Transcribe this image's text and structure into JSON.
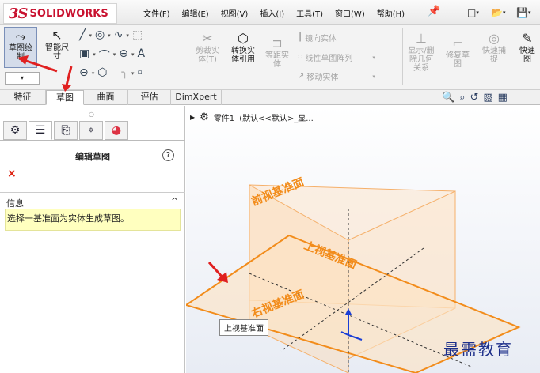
{
  "app": {
    "logo_mark": "3S",
    "logo_text": "SOLIDWORKS"
  },
  "menu": [
    "文件(F)",
    "编辑(E)",
    "视图(V)",
    "插入(I)",
    "工具(T)",
    "窗口(W)",
    "帮助(H)"
  ],
  "ribbon": {
    "sketch_label": "草图绘\n制",
    "smart_dim_label": "智能尺\n寸",
    "trim_label": "剪裁实\n体(T)",
    "convert_label": "转换实\n体引用",
    "offset_label": "等距实\n体",
    "mirror_label": "镜向实体",
    "linear_pattern_label": "线性草图阵列",
    "move_label": "移动实体",
    "display_delete_label": "显示/删\n除几何\n关系",
    "repair_label": "修复草\n图",
    "quick_snap_label": "快速捕\n捉",
    "quick_view_label": "快速\n图"
  },
  "tabs": [
    "特征",
    "草图",
    "曲面",
    "评估",
    "DimXpert"
  ],
  "active_tab": "草图",
  "panel": {
    "title": "编辑草图",
    "help": "?",
    "close": "×",
    "info_label": "信息",
    "info_caret": "^",
    "info_text": "选择一基准面为实体生成草图。"
  },
  "tree": {
    "part_label": "零件1",
    "config_label": "(默认<<默认>_显..."
  },
  "planes": {
    "front": "前视基准面",
    "top": "上视基准面",
    "right": "右视基准面"
  },
  "tooltip": "上视基准面",
  "watermark": "最需教育",
  "colors": {
    "plane_orange": "#f28c1b",
    "plane_fill": "#fde6cc",
    "highlight_red": "#e02020",
    "info_bg": "#ffffbf"
  }
}
